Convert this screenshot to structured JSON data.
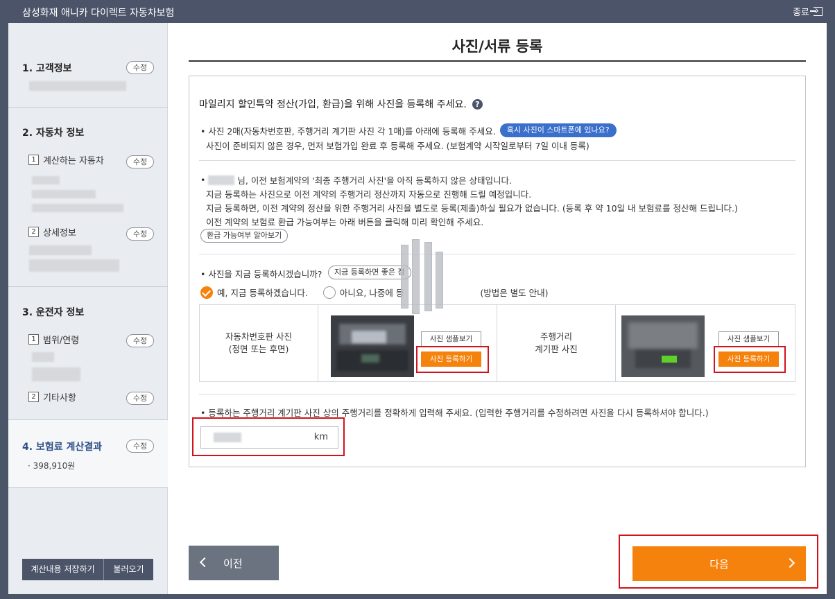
{
  "window": {
    "title": "삼성화재 애니카 다이렉트 자동차보험",
    "close_label": "종료"
  },
  "sidebar": {
    "sections": [
      {
        "title": "1. 고객정보",
        "edit": "수정"
      },
      {
        "title": "2. 자동차 정보",
        "subs": [
          {
            "num": "1",
            "label": "계산하는 자동차",
            "edit": "수정"
          },
          {
            "num": "2",
            "label": "상세정보",
            "edit": "수정"
          }
        ]
      },
      {
        "title": "3. 운전자 정보",
        "subs": [
          {
            "num": "1",
            "label": "범위/연령",
            "edit": "수정"
          },
          {
            "num": "2",
            "label": "기타사항",
            "edit": "수정"
          }
        ]
      },
      {
        "title": "4. 보험료 계산결과",
        "edit": "수정",
        "price": "· 398,910원"
      }
    ],
    "save_button": "계산내용 저장하기",
    "load_button": "불러오기"
  },
  "main": {
    "title": "사진/서류 등록",
    "headline": "마일리지 할인특약 정산(가입, 환급)을 위해 사진을 등록해 주세요.",
    "help_icon": "?",
    "p1_line1": "• 사진 2매(자동차번호판, 주행거리 계기판 사진 각 1매)를 아래에 등록해 주세요.",
    "p1_pill": "혹시 사진이 스마트폰에 있나요?",
    "p1_line2": "사진이 준비되지 않은 경우, 먼저 보험가입 완료 후 등록해 주세요. (보험계약 시작일로부터 7일 이내 등록)",
    "p2_line1": "님, 이전 보험계약의 '최종 주행거리 사진'을 아직 등록하지 않은 상태입니다.",
    "p2_line2": "지금 등록하는 사진으로 이전 계약의 주행거리 정산까지 자동으로 진행해 드릴 예정입니다.",
    "p2_line3": "지금 등록하면, 이전 계약의 정산을 위한 주행거리 사진을 별도로 등록(제출)하실 필요가 없습니다. (등록 후 약 10일 내 보험료를 정산해 드립니다.)",
    "p2_line4": "이전 계약의 보험료 환급 가능여부는 아래 버튼을 클릭해 미리 확인해 주세요.",
    "p2_pill": "환급 가능여부 알아보기",
    "q_text": "• 사진을 지금 등록하시겠습니까?",
    "q_pill": "지금 등록하면 좋은 점",
    "radio_yes": "예, 지금 등록하겠습니다.",
    "radio_no_a": "아니요, 나중에 등",
    "radio_no_b": "(방법은 별도 안내)",
    "plate_label_1": "자동차번호판 사진",
    "plate_label_2": "(정면 또는 후면)",
    "odo_label_1": "주행거리",
    "odo_label_2": "계기판 사진",
    "sample_button": "사진 샘플보기",
    "register_button": "사진 등록하기",
    "mileage_note": "• 등록하는 주행거리 계기판 사진 상의 주행거리를 정확하게 입력해 주세요. (입력한 주행거리를 수정하려면 사진을 다시 등록하셔야 합니다.)",
    "mileage_unit": "km",
    "prev_button": "이전",
    "next_button": "다음"
  },
  "colors": {
    "accent": "#f5820c",
    "header": "#4b5468",
    "highlight": "#d0121b",
    "link_blue": "#3a6fcc"
  }
}
